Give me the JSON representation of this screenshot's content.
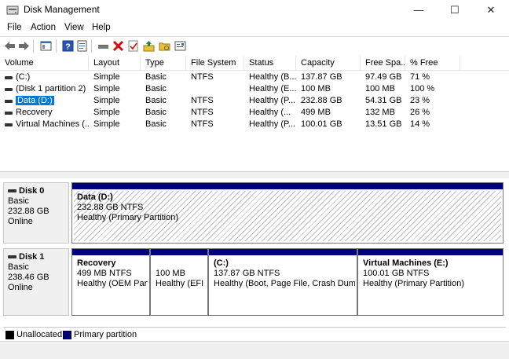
{
  "window": {
    "title": "Disk Management"
  },
  "menu": [
    {
      "label": "File"
    },
    {
      "label": "Action"
    },
    {
      "label": "View"
    },
    {
      "label": "Help"
    }
  ],
  "toolbar": [
    "back-icon",
    "forward-icon",
    "console-tree-icon",
    "help-icon",
    "properties-icon",
    "connect-icon",
    "delete-icon",
    "check-icon",
    "rescan-icon",
    "folder-icon",
    "settings-icon"
  ],
  "columns": [
    "Volume",
    "Layout",
    "Type",
    "File System",
    "Status",
    "Capacity",
    "Free Spa...",
    "% Free"
  ],
  "volumes": [
    {
      "volume": "(C:)",
      "layout": "Simple",
      "type": "Basic",
      "fs": "NTFS",
      "status": "Healthy (B...",
      "capacity": "137.87 GB",
      "free": "97.49 GB",
      "pct": "71 %"
    },
    {
      "volume": "(Disk 1 partition 2)",
      "layout": "Simple",
      "type": "Basic",
      "fs": "",
      "status": "Healthy (E...",
      "capacity": "100 MB",
      "free": "100 MB",
      "pct": "100 %"
    },
    {
      "volume": "Data (D:)",
      "layout": "Simple",
      "type": "Basic",
      "fs": "NTFS",
      "status": "Healthy (P...",
      "capacity": "232.88 GB",
      "free": "54.31 GB",
      "pct": "23 %"
    },
    {
      "volume": "Recovery",
      "layout": "Simple",
      "type": "Basic",
      "fs": "NTFS",
      "status": "Healthy (...",
      "capacity": "499 MB",
      "free": "132 MB",
      "pct": "26 %"
    },
    {
      "volume": "Virtual Machines (...",
      "layout": "Simple",
      "type": "Basic",
      "fs": "NTFS",
      "status": "Healthy (P...",
      "capacity": "100.01 GB",
      "free": "13.51 GB",
      "pct": "14 %"
    }
  ],
  "disks": [
    {
      "name": "Disk 0",
      "kind": "Basic",
      "size": "232.88 GB",
      "state": "Online",
      "partitions": [
        {
          "name": "Data  (D:)",
          "size": "232.88 GB NTFS",
          "status": "Healthy (Primary Partition)"
        }
      ]
    },
    {
      "name": "Disk 1",
      "kind": "Basic",
      "size": "238.46 GB",
      "state": "Online",
      "partitions": [
        {
          "name": "Recovery",
          "size": "499 MB NTFS",
          "status": "Healthy (OEM Parti"
        },
        {
          "name": "",
          "size": "100 MB",
          "status": "Healthy (EFI S"
        },
        {
          "name": "(C:)",
          "size": "137.87 GB NTFS",
          "status": "Healthy (Boot, Page File, Crash Dump, I"
        },
        {
          "name": "Virtual Machines  (E:)",
          "size": "100.01 GB NTFS",
          "status": "Healthy (Primary Partition)"
        }
      ]
    }
  ],
  "legend": [
    {
      "label": "Unallocated",
      "color": "#000000"
    },
    {
      "label": "Primary partition",
      "color": "#000080"
    }
  ],
  "colors": {
    "primary": "#000080",
    "selection": "#0078d7"
  }
}
